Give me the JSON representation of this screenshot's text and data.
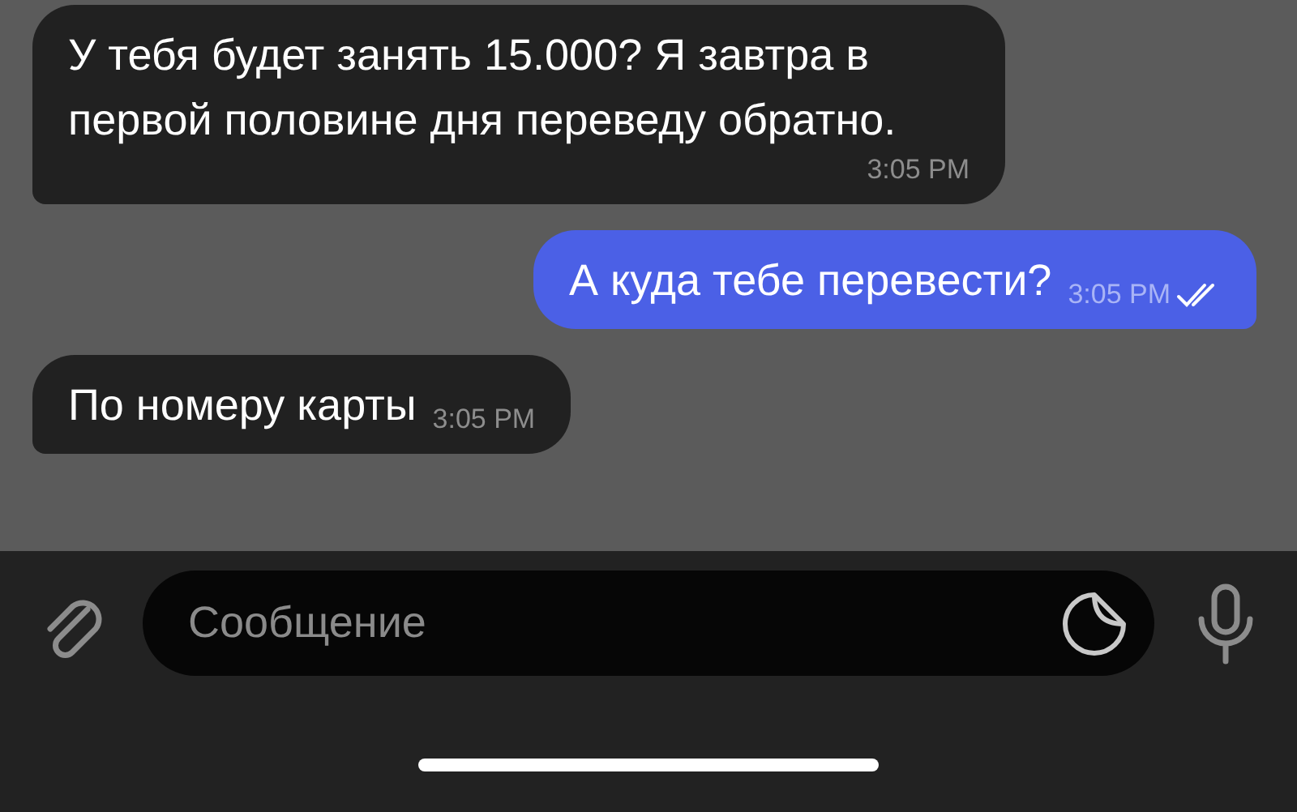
{
  "messages": [
    {
      "outgoing": false,
      "text": "У тебя будет занять 15.000? Я завтра в первой половине дня переведу обратно.",
      "time": "3:05 PM"
    },
    {
      "outgoing": true,
      "read": true,
      "text": "А куда тебе перевести?",
      "time": "3:05 PM"
    },
    {
      "outgoing": false,
      "text": "По номеру карты",
      "time": "3:05 PM"
    }
  ],
  "composer": {
    "placeholder": "Сообщение"
  }
}
